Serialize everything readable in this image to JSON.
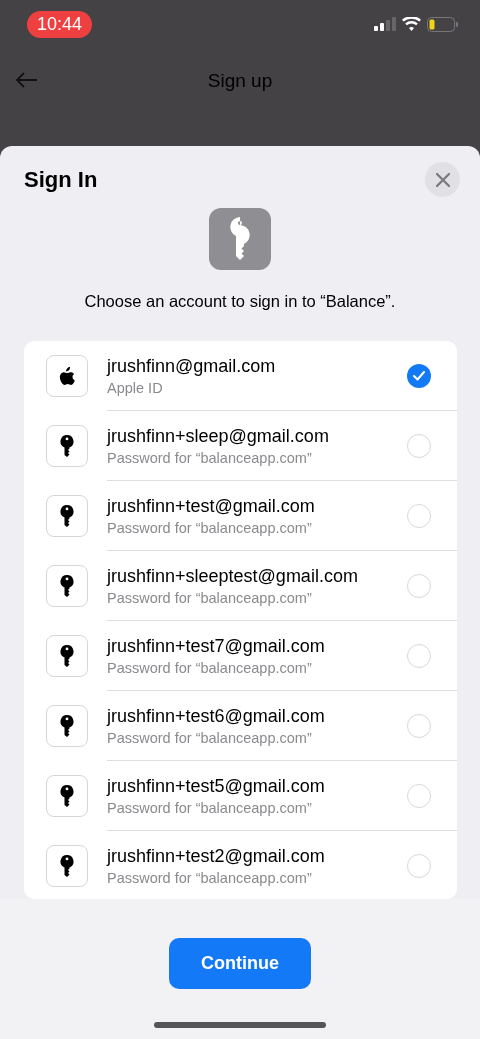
{
  "status_bar": {
    "time": "10:44"
  },
  "nav": {
    "title": "Sign up"
  },
  "sheet": {
    "title": "Sign In",
    "prompt": "Choose an account to sign in to “Balance”.",
    "accounts": [
      {
        "kind": "apple",
        "name": "jrushfinn@gmail.com",
        "detail": "Apple ID",
        "selected": true
      },
      {
        "kind": "password",
        "name": "jrushfinn+sleep@gmail.com",
        "detail": "Password for “balanceapp.com”",
        "selected": false
      },
      {
        "kind": "password",
        "name": "jrushfinn+test@gmail.com",
        "detail": "Password for “balanceapp.com”",
        "selected": false
      },
      {
        "kind": "password",
        "name": "jrushfinn+sleeptest@gmail.com",
        "detail": "Password for “balanceapp.com”",
        "selected": false
      },
      {
        "kind": "password",
        "name": "jrushfinn+test7@gmail.com",
        "detail": "Password for “balanceapp.com”",
        "selected": false
      },
      {
        "kind": "password",
        "name": "jrushfinn+test6@gmail.com",
        "detail": "Password for “balanceapp.com”",
        "selected": false
      },
      {
        "kind": "password",
        "name": "jrushfinn+test5@gmail.com",
        "detail": "Password for “balanceapp.com”",
        "selected": false
      },
      {
        "kind": "password",
        "name": "jrushfinn+test2@gmail.com",
        "detail": "Password for “balanceapp.com”",
        "selected": false
      }
    ],
    "button": "Continue"
  }
}
